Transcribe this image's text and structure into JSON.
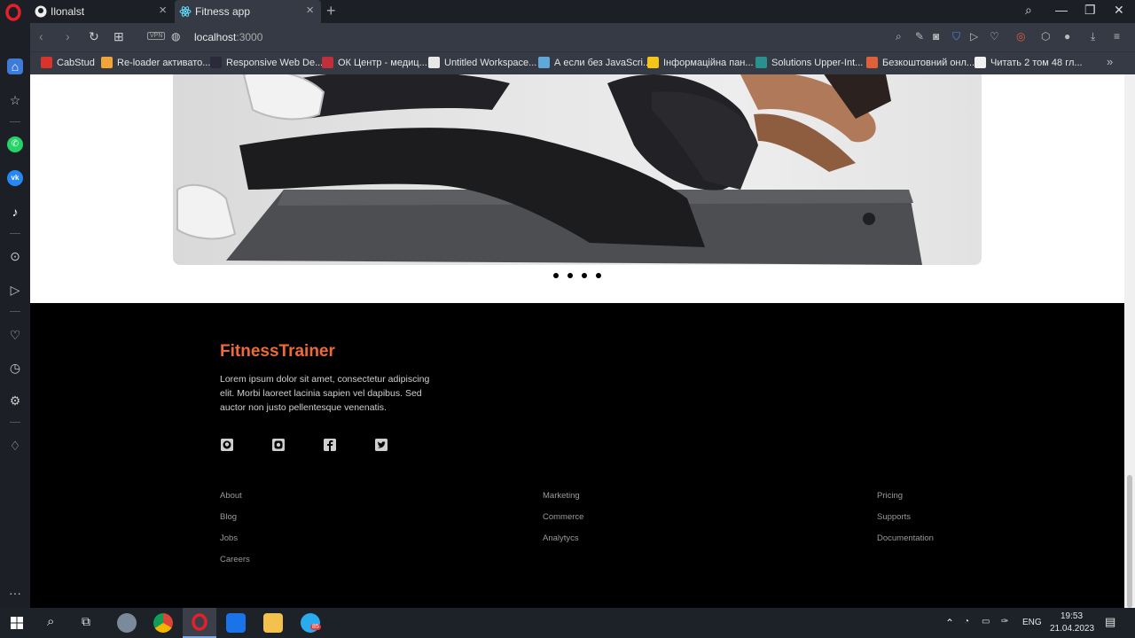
{
  "browser": {
    "tabs": [
      {
        "label": "Ilonalst"
      },
      {
        "label": "Fitness app"
      }
    ],
    "url_host": "localhost",
    "url_port": ":3000",
    "vpn_label": "VPN",
    "bookmarks": [
      {
        "label": "CabStud",
        "color": "#d9342b"
      },
      {
        "label": "Re-loader активато...",
        "color": "#f2a33a"
      },
      {
        "label": "Responsive Web De...",
        "color": "#2a2a3a"
      },
      {
        "label": "ОК Центр - медиц...",
        "color": "#c0303a"
      },
      {
        "label": "Untitled Workspace...",
        "color": "#e8e8e8"
      },
      {
        "label": "А если без JavaScri...",
        "color": "#5fa8d8"
      },
      {
        "label": "Інформаційна пан...",
        "color": "#f5c518"
      },
      {
        "label": "Solutions Upper-Int...",
        "color": "#2a8f8f"
      },
      {
        "label": "Безкоштовний онл...",
        "color": "#e0603a"
      },
      {
        "label": "Читать 2 том 48 гл...",
        "color": "#f0f0f0"
      }
    ]
  },
  "page": {
    "carousel_dots": 4,
    "footer": {
      "brand": "FitnessTrainer",
      "description": "Lorem ipsum dolor sit amet, consectetur adipiscing elit. Morbi laoreet lacinia sapien vel dapibus. Sed auctor non justo pellentesque venenatis.",
      "social_icons": [
        "github-icon",
        "instagram-icon",
        "facebook-icon",
        "twitter-icon"
      ],
      "columns": [
        {
          "links": [
            "About",
            "Blog",
            "Jobs",
            "Careers"
          ]
        },
        {
          "links": [
            "Marketing",
            "Commerce",
            "Analytycs"
          ]
        },
        {
          "links": [
            "Pricing",
            "Supports",
            "Documentation"
          ]
        }
      ]
    }
  },
  "taskbar": {
    "language": "ENG",
    "time": "19:53",
    "date": "21.04.2023",
    "telegram_badge": "85"
  },
  "colors": {
    "brand": "#ee6b35",
    "footer_bg": "#000000"
  }
}
